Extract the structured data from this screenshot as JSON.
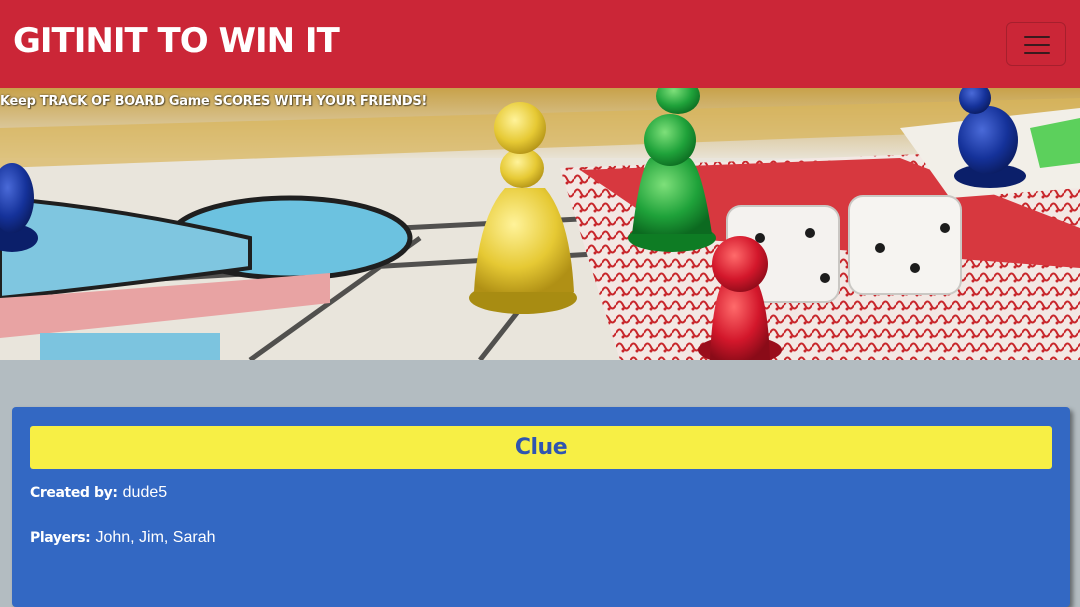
{
  "header": {
    "brand": "GITINIT TO WIN IT",
    "menu_icon": "hamburger-icon",
    "background_color": "#cb2637"
  },
  "hero": {
    "tagline": "Keep TRACK OF BOARD Game SCORES WITH YOUR FRIENDS!",
    "image": "board-game-pieces-and-dice"
  },
  "game": {
    "title": "Clue",
    "created_by_label": "Created by:",
    "created_by": "dude5",
    "players_label": "Players:",
    "players": "John, Jim, Sarah",
    "card_color": "#3368c3",
    "title_bar_color": "#f7ef45"
  }
}
